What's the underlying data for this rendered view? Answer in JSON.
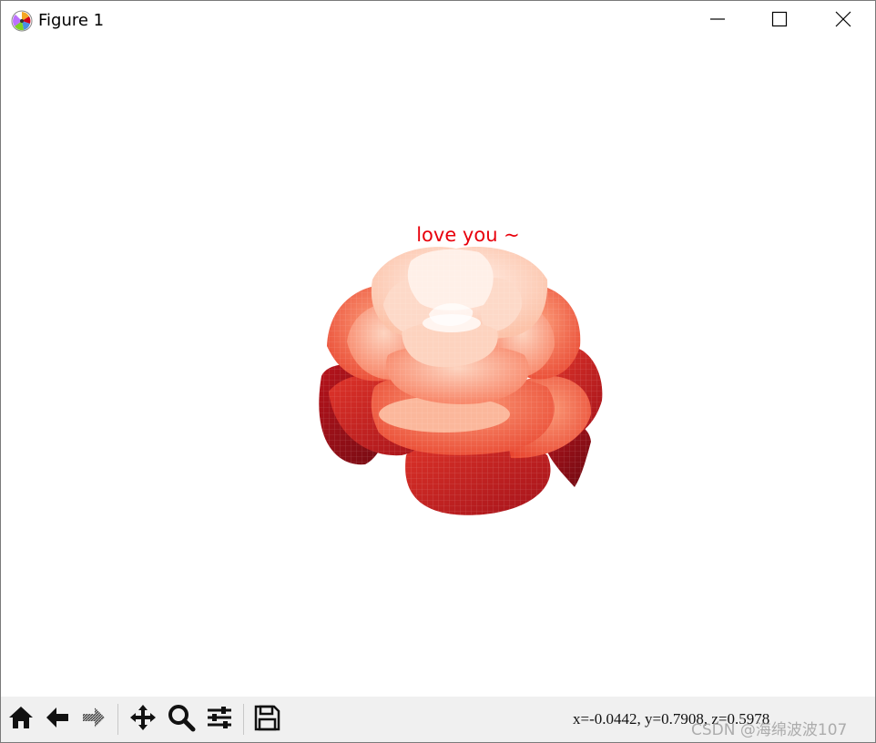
{
  "window": {
    "title": "Figure 1",
    "app_icon": "matplotlib-logo-icon",
    "controls": [
      "minimize-icon",
      "maximize-icon",
      "close-icon"
    ]
  },
  "figure": {
    "title": "love you ~",
    "title_color": "#e8000b",
    "subject": "3D surface rose plot",
    "colormap": "Reds"
  },
  "toolbar": {
    "buttons": [
      {
        "name": "home",
        "icon": "home-icon"
      },
      {
        "name": "back",
        "icon": "arrow-left-icon"
      },
      {
        "name": "forward",
        "icon": "arrow-right-icon"
      },
      {
        "name": "pan",
        "icon": "move-icon"
      },
      {
        "name": "zoom",
        "icon": "zoom-magnifier-icon"
      },
      {
        "name": "configure-subplots",
        "icon": "sliders-icon"
      },
      {
        "name": "save",
        "icon": "save-floppy-icon"
      }
    ],
    "coordinates": "x=-0.0442, y=0.7908, z=0.5978"
  },
  "watermark": "CSDN @海绵波波107"
}
